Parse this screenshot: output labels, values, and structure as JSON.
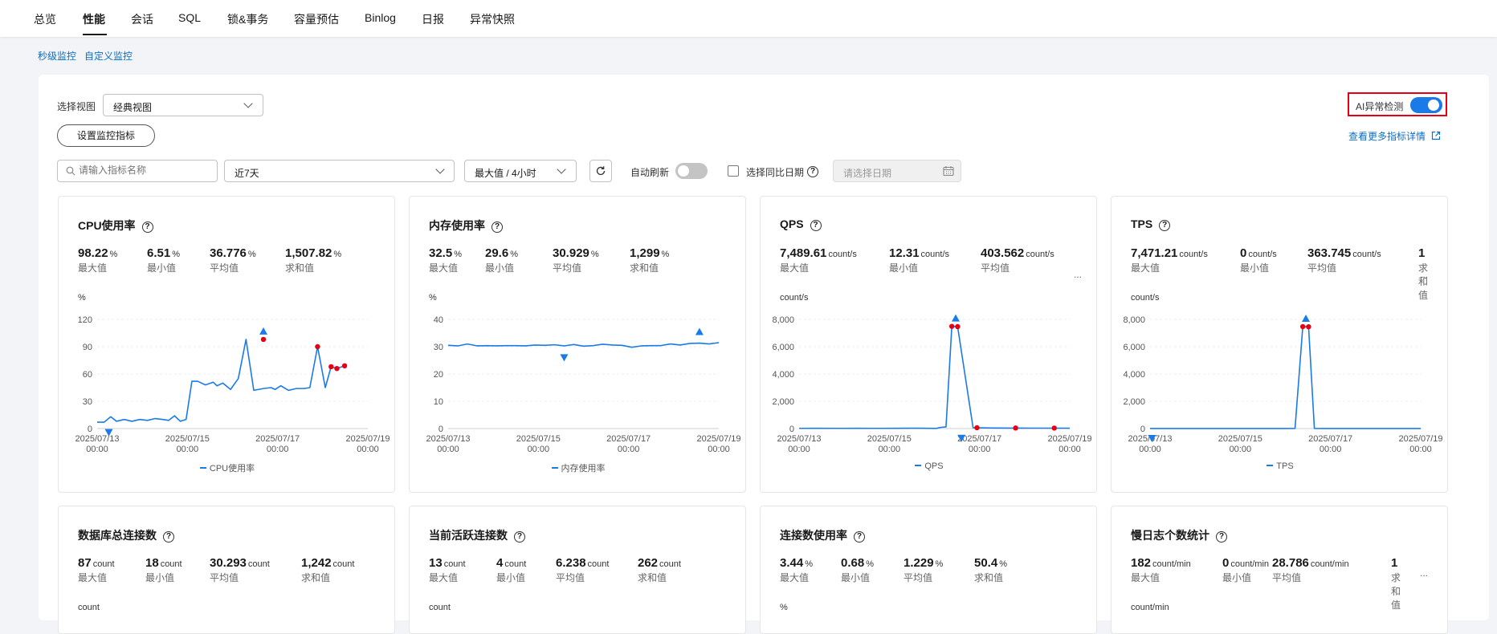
{
  "nav": {
    "tabs": [
      "总览",
      "性能",
      "会话",
      "SQL",
      "锁&事务",
      "容量预估",
      "Binlog",
      "日报",
      "异常快照"
    ],
    "active": 1
  },
  "sublinks": [
    "秒级监控",
    "自定义监控"
  ],
  "toolbar": {
    "view_label": "选择视图",
    "view_value": "经典视图",
    "set_metrics": "设置监控指标",
    "ai_label": "AI异常检测",
    "more_details": "查看更多指标详情",
    "search_placeholder": "请输入指标名称",
    "range_value": "近7天",
    "agg_value": "最大值 / 4小时",
    "auto_refresh": "自动刷新",
    "compare_date": "选择同比日期",
    "date_placeholder": "请选择日期"
  },
  "colors": {
    "line": "#1a7ae8",
    "anomaly": "#e60012",
    "accent": "#1a7ae8",
    "highlight_box": "#e60012"
  },
  "stat_labels": [
    "最大值",
    "最小值",
    "平均值",
    "求和值"
  ],
  "cards": [
    {
      "title": "CPU使用率",
      "stats": [
        {
          "value": "98.22",
          "unit": "%"
        },
        {
          "value": "6.51",
          "unit": "%"
        },
        {
          "value": "36.776",
          "unit": "%"
        },
        {
          "value": "1,507.82",
          "unit": "%"
        }
      ],
      "more": "",
      "unit": "%",
      "legend": "CPU使用率"
    },
    {
      "title": "内存使用率",
      "stats": [
        {
          "value": "32.5",
          "unit": "%"
        },
        {
          "value": "29.6",
          "unit": "%"
        },
        {
          "value": "30.929",
          "unit": "%"
        },
        {
          "value": "1,299",
          "unit": "%"
        }
      ],
      "more": "",
      "unit": "%",
      "legend": "内存使用率"
    },
    {
      "title": "QPS",
      "stats": [
        {
          "value": "7,489.61",
          "unit": "count/s"
        },
        {
          "value": "12.31",
          "unit": "count/s"
        },
        {
          "value": "403.562",
          "unit": "count/s"
        }
      ],
      "more": "...",
      "unit": "count/s",
      "legend": "QPS"
    },
    {
      "title": "TPS",
      "stats": [
        {
          "value": "7,471.21",
          "unit": "count/s"
        },
        {
          "value": "0",
          "unit": "count/s"
        },
        {
          "value": "363.745",
          "unit": "count/s"
        },
        {
          "value": "1",
          "unit": ""
        }
      ],
      "more": "...",
      "unit": "count/s",
      "legend": "TPS"
    },
    {
      "title": "数据库总连接数",
      "stats": [
        {
          "value": "87",
          "unit": "count"
        },
        {
          "value": "18",
          "unit": "count"
        },
        {
          "value": "30.293",
          "unit": "count"
        },
        {
          "value": "1,242",
          "unit": "count"
        }
      ],
      "more": "",
      "unit": "count"
    },
    {
      "title": "当前活跃连接数",
      "stats": [
        {
          "value": "13",
          "unit": "count"
        },
        {
          "value": "4",
          "unit": "count"
        },
        {
          "value": "6.238",
          "unit": "count"
        },
        {
          "value": "262",
          "unit": "count"
        }
      ],
      "more": "",
      "unit": "count"
    },
    {
      "title": "连接数使用率",
      "stats": [
        {
          "value": "3.44",
          "unit": "%"
        },
        {
          "value": "0.68",
          "unit": "%"
        },
        {
          "value": "1.229",
          "unit": "%"
        },
        {
          "value": "50.4",
          "unit": "%"
        }
      ],
      "more": "",
      "unit": "%"
    },
    {
      "title": "慢日志个数统计",
      "stats": [
        {
          "value": "182",
          "unit": "count/min"
        },
        {
          "value": "0",
          "unit": "count/min"
        },
        {
          "value": "28.786",
          "unit": "count/min"
        },
        {
          "value": "1",
          "unit": ""
        }
      ],
      "more": "...",
      "unit": "count/min"
    }
  ],
  "chart_data": [
    {
      "type": "line",
      "title": "CPU使用率",
      "ylabel": "%",
      "ylim": [
        0,
        120
      ],
      "yticks": [
        0,
        30,
        60,
        90,
        120
      ],
      "xticks": [
        "2025/07/13 00:00",
        "2025/07/15 00:00",
        "2025/07/17 00:00",
        "2025/07/19 00:00"
      ],
      "xlim": [
        0,
        7
      ],
      "series": [
        {
          "name": "CPU使用率",
          "x": [
            0,
            0.18,
            0.35,
            0.5,
            0.7,
            0.9,
            1.1,
            1.3,
            1.5,
            1.7,
            1.85,
            2.0,
            2.15,
            2.3,
            2.45,
            2.6,
            2.8,
            3.0,
            3.1,
            3.25,
            3.45,
            3.65,
            3.85,
            4.05,
            4.3,
            4.5,
            4.6,
            4.75,
            4.95,
            5.15,
            5.35,
            5.5,
            5.7,
            5.9,
            6.05,
            6.2,
            6.4
          ],
          "y": [
            7,
            7,
            13,
            8,
            10,
            8,
            10,
            9,
            11,
            10,
            9,
            14,
            8,
            10,
            52,
            52,
            48,
            51,
            47,
            50,
            43,
            55,
            98,
            42,
            44,
            45,
            43,
            47,
            42,
            44,
            44,
            45,
            90,
            45,
            68,
            66,
            69
          ]
        }
      ],
      "anomaly_points": [
        {
          "x": 4.3,
          "y": 98
        },
        {
          "x": 5.7,
          "y": 90
        },
        {
          "x": 6.05,
          "y": 68
        },
        {
          "x": 6.2,
          "y": 66
        },
        {
          "x": 6.4,
          "y": 69
        }
      ],
      "markers": [
        {
          "kind": "max",
          "x": 4.3,
          "y": 98
        },
        {
          "kind": "min",
          "x": 0.3,
          "y": 6.51
        }
      ]
    },
    {
      "type": "line",
      "title": "内存使用率",
      "ylabel": "%",
      "ylim": [
        0,
        40
      ],
      "yticks": [
        0,
        10,
        20,
        30,
        40
      ],
      "xticks": [
        "2025/07/13 00:00",
        "2025/07/15 00:00",
        "2025/07/17 00:00",
        "2025/07/19 00:00"
      ],
      "xlim": [
        0,
        7
      ],
      "series": [
        {
          "name": "内存使用率",
          "x": [
            0,
            0.25,
            0.5,
            0.75,
            1.0,
            1.25,
            1.5,
            1.75,
            2.0,
            2.25,
            2.5,
            2.75,
            3.0,
            3.25,
            3.5,
            3.75,
            4.0,
            4.25,
            4.5,
            4.75,
            5.0,
            5.25,
            5.5,
            5.75,
            6.0,
            6.25,
            6.5,
            6.75,
            7.0
          ],
          "y": [
            30.5,
            30.3,
            31.0,
            30.3,
            30.4,
            30.3,
            30.4,
            30.4,
            30.3,
            30.6,
            30.5,
            30.7,
            30.3,
            30.8,
            30.2,
            30.4,
            30.9,
            30.6,
            30.5,
            29.8,
            30.3,
            30.4,
            30.4,
            31.0,
            30.6,
            31.2,
            31.3,
            31.0,
            31.5
          ]
        }
      ],
      "anomaly_points": [],
      "markers": [
        {
          "kind": "max",
          "x": 6.5,
          "y": 32.5
        },
        {
          "kind": "min",
          "x": 3.0,
          "y": 29.6
        }
      ]
    },
    {
      "type": "line",
      "title": "QPS",
      "ylabel": "count/s",
      "ylim": [
        0,
        8000
      ],
      "yticks": [
        0,
        2000,
        4000,
        6000,
        8000
      ],
      "xticks": [
        "2025/07/13 00:00",
        "2025/07/15 00:00",
        "2025/07/17 00:00",
        "2025/07/19 00:00"
      ],
      "xlim": [
        0,
        7
      ],
      "series": [
        {
          "name": "QPS",
          "x": [
            0,
            0.5,
            1.0,
            1.5,
            2.0,
            2.5,
            3.0,
            3.3,
            3.55,
            3.65,
            3.8,
            3.95,
            4.1,
            4.5,
            5.0,
            5.5,
            6.0,
            6.5,
            7.0
          ],
          "y": [
            15,
            20,
            15,
            20,
            15,
            20,
            25,
            20,
            12,
            80,
            120,
            7490,
            7470,
            60,
            40,
            35,
            30,
            30,
            25
          ]
        }
      ],
      "anomaly_points": [
        {
          "x": 3.95,
          "y": 7490
        },
        {
          "x": 4.1,
          "y": 7470
        },
        {
          "x": 4.6,
          "y": 60
        },
        {
          "x": 5.6,
          "y": 40
        },
        {
          "x": 6.6,
          "y": 35
        }
      ],
      "markers": [
        {
          "kind": "max",
          "x": 4.05,
          "y": 7489.61
        },
        {
          "kind": "min",
          "x": 4.2,
          "y": 12.31
        }
      ]
    },
    {
      "type": "line",
      "title": "TPS",
      "ylabel": "count/s",
      "ylim": [
        0,
        8000
      ],
      "yticks": [
        0,
        2000,
        4000,
        6000,
        8000
      ],
      "xticks": [
        "2025/07/13 00:00",
        "2025/07/15 00:00",
        "2025/07/17 00:00",
        "2025/07/19 00:00"
      ],
      "xlim": [
        0,
        7
      ],
      "series": [
        {
          "name": "TPS",
          "x": [
            0,
            0.5,
            1.0,
            1.5,
            2.0,
            2.5,
            3.0,
            3.5,
            3.75,
            3.95,
            4.1,
            4.25,
            4.5,
            5.0,
            5.5,
            6.0,
            6.5,
            7.0
          ],
          "y": [
            5,
            5,
            5,
            5,
            5,
            5,
            5,
            5,
            10,
            7471,
            7460,
            10,
            5,
            5,
            5,
            5,
            5,
            5
          ]
        }
      ],
      "anomaly_points": [
        {
          "x": 3.95,
          "y": 7471
        },
        {
          "x": 4.1,
          "y": 7460
        }
      ],
      "markers": [
        {
          "kind": "max",
          "x": 4.03,
          "y": 7471.21
        },
        {
          "kind": "min",
          "x": 0.05,
          "y": 0
        }
      ]
    }
  ]
}
